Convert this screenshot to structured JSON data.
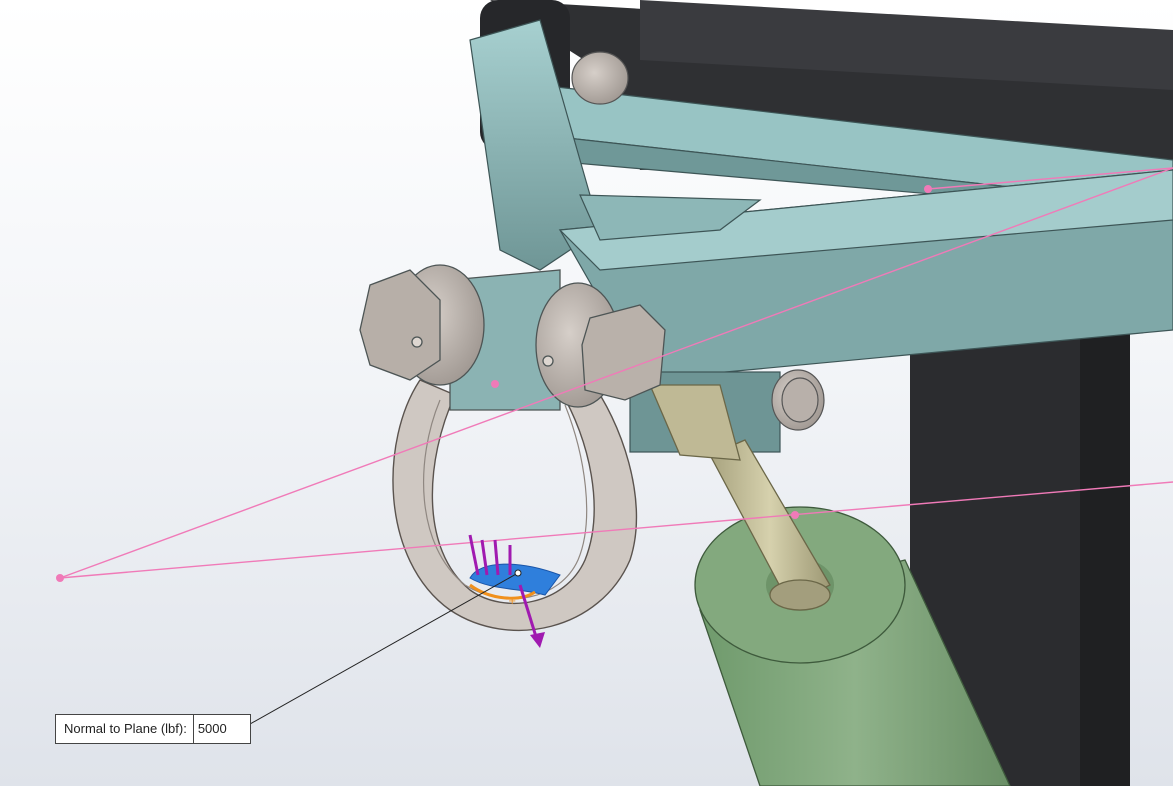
{
  "callout": {
    "label": "Normal to Plane (lbf):",
    "value": "5000"
  },
  "colors": {
    "frame_black": "#2b2c2f",
    "mount_teal": "#9cc6c6",
    "shackle_gray": "#cfc8c2",
    "actuator_green": "#7ea17a",
    "rod_tan": "#c9c3a0",
    "sketch_pink": "#f07ab8",
    "load_arrow_purple": "#a01ab0",
    "face_blue": "#2f7fdc",
    "edge_orange": "#f0901c"
  },
  "icons": [
    "load-arrow-icon",
    "selected-face-icon",
    "sketch-point-icon",
    "leader-anchor-icon"
  ]
}
